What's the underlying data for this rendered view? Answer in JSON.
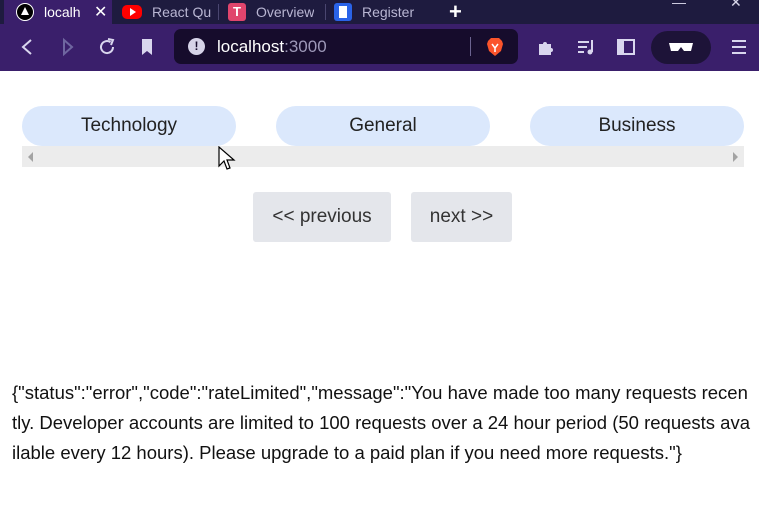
{
  "browser": {
    "tabs": [
      {
        "label": "localh",
        "favicon": "nextjs-icon",
        "active": true
      },
      {
        "label": "React Qu",
        "favicon": "youtube-icon",
        "active": false
      },
      {
        "label": "Overview",
        "favicon": "t-logo-icon",
        "active": false
      },
      {
        "label": "Register",
        "favicon": "register-icon",
        "active": false
      }
    ],
    "favicon_letter_t": "T",
    "new_tab_icon": "plus-icon",
    "address_bar": {
      "host": "localhost",
      "port": ":3000",
      "info_icon": "!"
    },
    "toolbar_icons": [
      "back-icon",
      "forward-icon",
      "reload-icon",
      "bookmark-icon",
      "brave-shield-icon",
      "extensions-icon",
      "playlist-icon",
      "sidebar-icon",
      "private-glasses-icon",
      "menu-icon"
    ],
    "colors": {
      "tabstrip_bg": "#1e1b3f",
      "toolbar_bg": "#3a1f6b",
      "urlbar_bg": "#160c2c"
    }
  },
  "page": {
    "categories": [
      {
        "label": "Technology"
      },
      {
        "label": "General"
      },
      {
        "label": "Business"
      }
    ],
    "pagination": {
      "previous_label": "<< previous",
      "next_label": "next >>"
    },
    "error_response": "{\"status\":\"error\",\"code\":\"rateLimited\",\"message\":\"You have made too many requests recently. Developer accounts are limited to 100 requests over a 24 hour period (50 requests available every 12 hours). Please upgrade to a paid plan if you need more requests.\"}",
    "colors": {
      "category_bg": "#dbe8fc",
      "pager_bg": "#e4e6eb"
    }
  }
}
